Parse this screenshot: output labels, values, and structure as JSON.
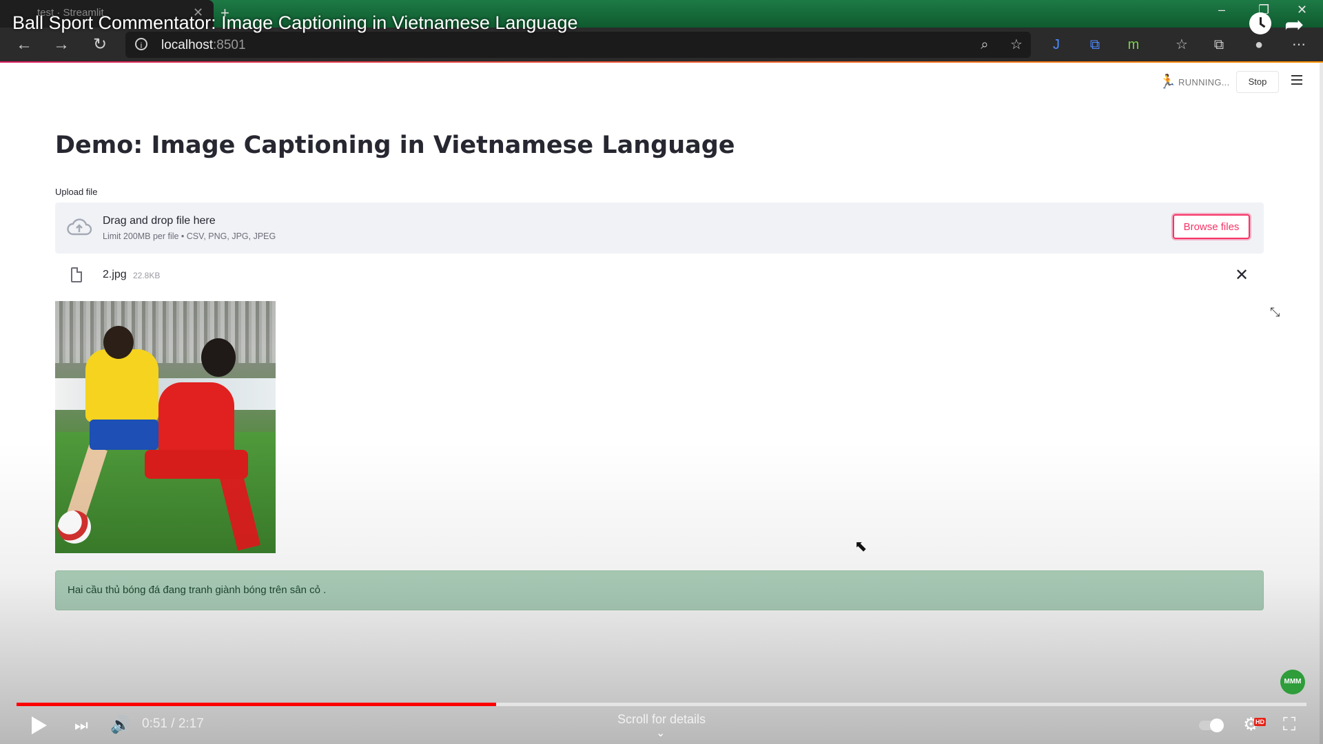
{
  "browser": {
    "tab_title": "test · Streamlit",
    "url_host": "localhost",
    "url_port": ":8501"
  },
  "video": {
    "title": "Ball Sport Commentator: Image Captioning in Vietnamese Language",
    "current_time": "0:51",
    "duration": "2:17",
    "time_display": "0:51 / 2:17",
    "progress_fraction": 0.372,
    "scroll_hint": "Scroll for details",
    "hd_badge": "HD",
    "channel_badge": "MMM"
  },
  "app": {
    "status_text": "RUNNING...",
    "stop_label": "Stop",
    "page_title": "Demo: Image Captioning in Vietnamese Language",
    "upload_label": "Upload file",
    "dropzone": {
      "title": "Drag and drop file here",
      "subtitle": "Limit 200MB per file • CSV, PNG, JPG, JPEG",
      "browse_label": "Browse files"
    },
    "file": {
      "name": "2.jpg",
      "size": "22.8KB"
    },
    "caption": "Hai cầu thủ bóng đá đang tranh giành bóng trên sân cỏ ."
  },
  "colors": {
    "accent": "#f63366",
    "success_bg": "#afd3bd",
    "progress": "#ff0000"
  }
}
